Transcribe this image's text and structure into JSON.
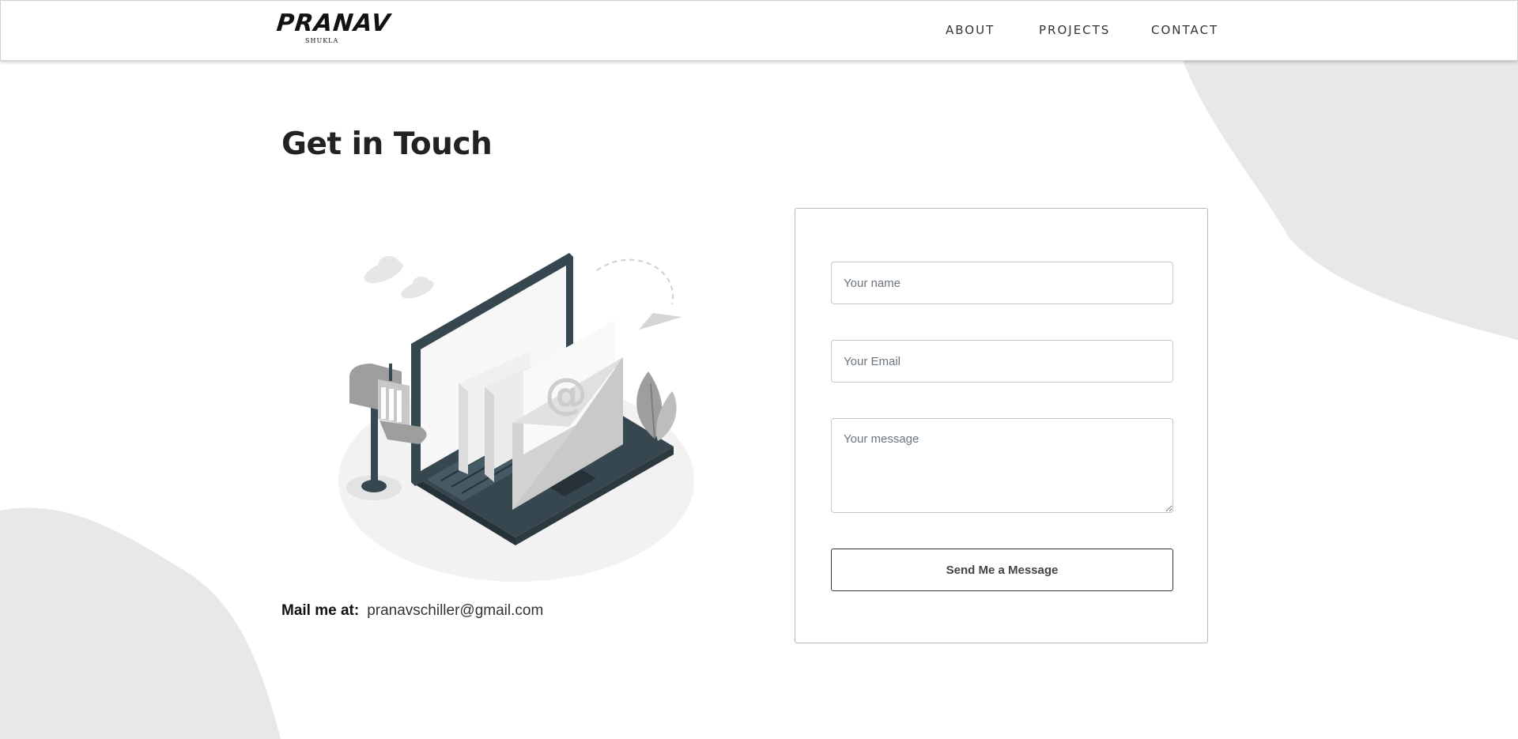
{
  "nav": {
    "logo_main": "PRANAV",
    "logo_sub": "SHUKLA",
    "items": [
      {
        "label": "ABOUT"
      },
      {
        "label": "PROJECTS"
      },
      {
        "label": "CONTACT"
      }
    ]
  },
  "contact": {
    "heading": "Get in Touch",
    "mail_label": "Mail me at:",
    "mail_value": "pranavschiller@gmail.com"
  },
  "form": {
    "name_placeholder": "Your name",
    "email_placeholder": "Your Email",
    "message_placeholder": "Your message",
    "submit_label": "Send Me a Message"
  },
  "illustration": {
    "icon": "email-laptop-illustration",
    "symbol": "@"
  },
  "colors": {
    "background": "#ffffff",
    "blob": "#e8e8e8",
    "text": "#222222",
    "laptop_dark": "#37474f"
  }
}
